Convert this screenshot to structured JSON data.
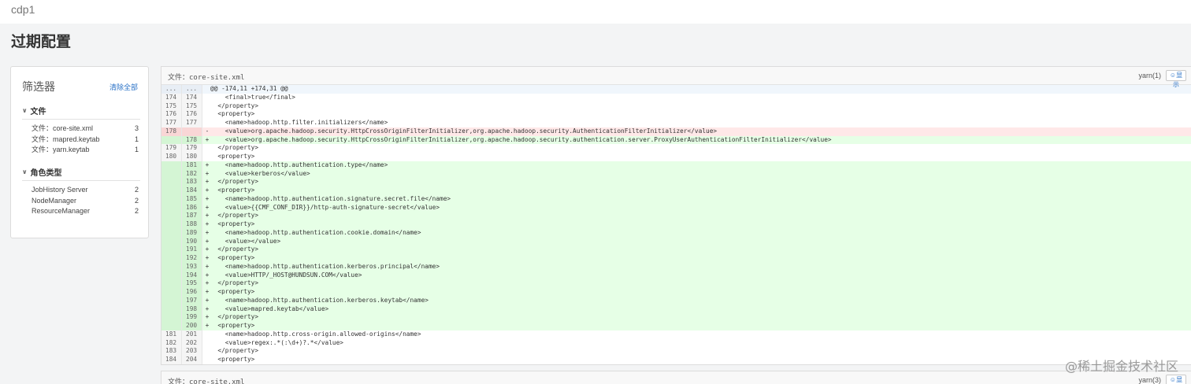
{
  "header": {
    "cluster": "cdp1",
    "title": "过期配置"
  },
  "filter": {
    "title": "筛选器",
    "clear_all": "清除全部",
    "sections": [
      {
        "label": "文件",
        "items": [
          {
            "label": "文件：core-site.xml",
            "count": "3"
          },
          {
            "label": "文件：mapred.keytab",
            "count": "1"
          },
          {
            "label": "文件：yarn.keytab",
            "count": "1"
          }
        ]
      },
      {
        "label": "角色类型",
        "items": [
          {
            "label": "JobHistory Server",
            "count": "2"
          },
          {
            "label": "NodeManager",
            "count": "2"
          },
          {
            "label": "ResourceManager",
            "count": "2"
          }
        ]
      }
    ]
  },
  "diffs": [
    {
      "file": "文件：core-site.xml",
      "role": "yarn(1)",
      "show_label": "显示",
      "lines": [
        {
          "type": "hunk",
          "n1": "...",
          "n2": "...",
          "mark": "",
          "code": "@@ -174,11 +174,31 @@"
        },
        {
          "type": "ctx",
          "n1": "174",
          "n2": "174",
          "mark": "",
          "code": "    <final>true</final>"
        },
        {
          "type": "ctx",
          "n1": "175",
          "n2": "175",
          "mark": "",
          "code": "  </property>"
        },
        {
          "type": "ctx",
          "n1": "176",
          "n2": "176",
          "mark": "",
          "code": "  <property>"
        },
        {
          "type": "ctx",
          "n1": "177",
          "n2": "177",
          "mark": "",
          "code": "    <name>hadoop.http.filter.initializers</name>"
        },
        {
          "type": "del",
          "n1": "178",
          "n2": "",
          "mark": "-",
          "code": "    <value>org.apache.hadoop.security.HttpCrossOriginFilterInitializer,org.apache.hadoop.security.AuthenticationFilterInitializer</value>"
        },
        {
          "type": "add",
          "n1": "",
          "n2": "178",
          "mark": "+",
          "code": "    <value>org.apache.hadoop.security.HttpCrossOriginFilterInitializer,org.apache.hadoop.security.authentication.server.ProxyUserAuthenticationFilterInitializer</value>"
        },
        {
          "type": "ctx",
          "n1": "179",
          "n2": "179",
          "mark": "",
          "code": "  </property>"
        },
        {
          "type": "ctx",
          "n1": "180",
          "n2": "180",
          "mark": "",
          "code": "  <property>"
        },
        {
          "type": "add",
          "n1": "",
          "n2": "181",
          "mark": "+",
          "code": "    <name>hadoop.http.authentication.type</name>"
        },
        {
          "type": "add",
          "n1": "",
          "n2": "182",
          "mark": "+",
          "code": "    <value>kerberos</value>"
        },
        {
          "type": "add",
          "n1": "",
          "n2": "183",
          "mark": "+",
          "code": "  </property>"
        },
        {
          "type": "add",
          "n1": "",
          "n2": "184",
          "mark": "+",
          "code": "  <property>"
        },
        {
          "type": "add",
          "n1": "",
          "n2": "185",
          "mark": "+",
          "code": "    <name>hadoop.http.authentication.signature.secret.file</name>"
        },
        {
          "type": "add",
          "n1": "",
          "n2": "186",
          "mark": "+",
          "code": "    <value>{{CMF_CONF_DIR}}/http-auth-signature-secret</value>"
        },
        {
          "type": "add",
          "n1": "",
          "n2": "187",
          "mark": "+",
          "code": "  </property>"
        },
        {
          "type": "add",
          "n1": "",
          "n2": "188",
          "mark": "+",
          "code": "  <property>"
        },
        {
          "type": "add",
          "n1": "",
          "n2": "189",
          "mark": "+",
          "code": "    <name>hadoop.http.authentication.cookie.domain</name>"
        },
        {
          "type": "add",
          "n1": "",
          "n2": "190",
          "mark": "+",
          "code": "    <value></value>"
        },
        {
          "type": "add",
          "n1": "",
          "n2": "191",
          "mark": "+",
          "code": "  </property>"
        },
        {
          "type": "add",
          "n1": "",
          "n2": "192",
          "mark": "+",
          "code": "  <property>"
        },
        {
          "type": "add",
          "n1": "",
          "n2": "193",
          "mark": "+",
          "code": "    <name>hadoop.http.authentication.kerberos.principal</name>"
        },
        {
          "type": "add",
          "n1": "",
          "n2": "194",
          "mark": "+",
          "code": "    <value>HTTP/_HOST@HUNDSUN.COM</value>"
        },
        {
          "type": "add",
          "n1": "",
          "n2": "195",
          "mark": "+",
          "code": "  </property>"
        },
        {
          "type": "add",
          "n1": "",
          "n2": "196",
          "mark": "+",
          "code": "  <property>"
        },
        {
          "type": "add",
          "n1": "",
          "n2": "197",
          "mark": "+",
          "code": "    <name>hadoop.http.authentication.kerberos.keytab</name>"
        },
        {
          "type": "add",
          "n1": "",
          "n2": "198",
          "mark": "+",
          "code": "    <value>mapred.keytab</value>"
        },
        {
          "type": "add",
          "n1": "",
          "n2": "199",
          "mark": "+",
          "code": "  </property>"
        },
        {
          "type": "add",
          "n1": "",
          "n2": "200",
          "mark": "+",
          "code": "  <property>"
        },
        {
          "type": "ctx",
          "n1": "181",
          "n2": "201",
          "mark": "",
          "code": "    <name>hadoop.http.cross-origin.allowed-origins</name>"
        },
        {
          "type": "ctx",
          "n1": "182",
          "n2": "202",
          "mark": "",
          "code": "    <value>regex:.*(:\\d+)?.*</value>"
        },
        {
          "type": "ctx",
          "n1": "183",
          "n2": "203",
          "mark": "",
          "code": "  </property>"
        },
        {
          "type": "ctx",
          "n1": "184",
          "n2": "204",
          "mark": "",
          "code": "  <property>"
        }
      ]
    },
    {
      "file": "文件：core-site.xml",
      "role": "yarn(3)",
      "show_label": "显示"
    }
  ],
  "watermark": "@稀土掘金技术社区"
}
